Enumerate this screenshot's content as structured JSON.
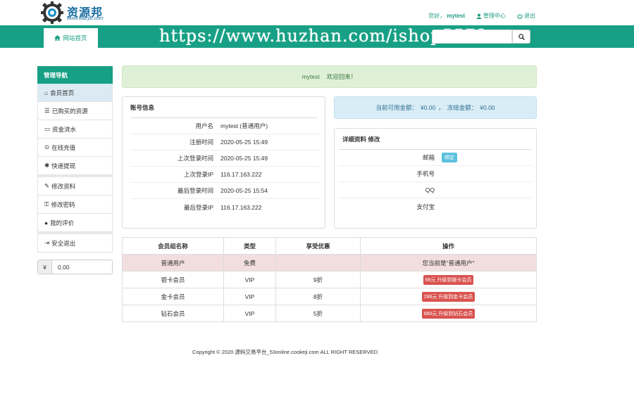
{
  "header": {
    "logo_title": "资源邦",
    "logo_url": "www.wazyb.com",
    "greeting": "您好，",
    "username": "mytest",
    "admin_link": "管理中心",
    "logout_link": "退出"
  },
  "nav": {
    "home_tab": "网站首页",
    "watermark": "https://www.huzhan.com/ishop5572",
    "search_placeholder": ""
  },
  "sidebar": {
    "title": "管理导航",
    "items": [
      {
        "label": "会员首页",
        "icon": "home-icon"
      },
      {
        "label": "已购买的资源",
        "icon": "list-icon"
      },
      {
        "label": "资金流水",
        "icon": "card-icon"
      },
      {
        "label": "在线充值",
        "icon": "coin-icon"
      },
      {
        "label": "快速提现",
        "icon": "gift-icon"
      },
      {
        "label": "修改资料",
        "icon": "pencil-icon"
      },
      {
        "label": "修改密码",
        "icon": "key-icon"
      },
      {
        "label": "我的评价",
        "icon": "comment-icon"
      },
      {
        "label": "安全退出",
        "icon": "exit-icon"
      }
    ],
    "balance_symbol": "¥",
    "balance_value": "0.00"
  },
  "welcome": {
    "user": "mytest",
    "text": "欢迎回来！"
  },
  "account": {
    "title": "账号信息",
    "rows": [
      {
        "key": "用户名",
        "value": "mytest (普通用户)"
      },
      {
        "key": "注册时间",
        "value": "2020-05-25 15:49"
      },
      {
        "key": "上次登录时间",
        "value": "2020-05-25 15:49"
      },
      {
        "key": "上次登录IP",
        "value": "116.17.163.222"
      },
      {
        "key": "最后登录时间",
        "value": "2020-05-25 15:54"
      },
      {
        "key": "最后登录IP",
        "value": "116.17.163.222"
      }
    ]
  },
  "funds": {
    "available_label": "当前可用金额：",
    "available_value": "¥0.00",
    "sep": "，",
    "frozen_label": "冻结金额：",
    "frozen_value": "¥0.00"
  },
  "detail": {
    "title": "详细资料",
    "edit_link": "修改",
    "rows": [
      {
        "key": "邮箱",
        "badge": "绑定"
      },
      {
        "key": "手机号",
        "badge": ""
      },
      {
        "key": "QQ",
        "badge": ""
      },
      {
        "key": "支付宝",
        "badge": ""
      }
    ]
  },
  "levels": {
    "headers": [
      "会员组名称",
      "类型",
      "享受优惠",
      "操作"
    ],
    "rows": [
      {
        "name": "普通用户",
        "type": "免费",
        "discount": "",
        "action": "您当前是\"普通用户\"",
        "upgrade": false
      },
      {
        "name": "银卡会员",
        "type": "VIP",
        "discount": "9折",
        "action": "66元 升级到银卡会员",
        "upgrade": true
      },
      {
        "name": "金卡会员",
        "type": "VIP",
        "discount": "8折",
        "action": "288元 升级到金卡会员",
        "upgrade": true
      },
      {
        "name": "钻石会员",
        "type": "VIP",
        "discount": "5折",
        "action": "680元 升级到钻石会员",
        "upgrade": true
      }
    ]
  },
  "footer": {
    "text": "Copyright © 2020 源码交易平台_53online.cookeji.com ALL RIGHT RESERVED"
  }
}
